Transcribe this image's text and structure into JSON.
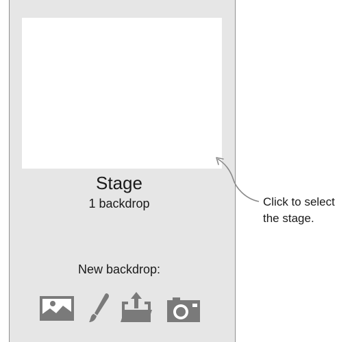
{
  "stage_panel": {
    "title": "Stage",
    "backdrop_count": "1 backdrop",
    "new_backdrop_label": "New backdrop:",
    "backdrop_options": [
      {
        "icon": "image-icon",
        "action": "choose-backdrop-from-library"
      },
      {
        "icon": "paintbrush-icon",
        "action": "paint-new-backdrop"
      },
      {
        "icon": "upload-icon",
        "action": "upload-backdrop-from-file"
      },
      {
        "icon": "camera-icon",
        "action": "new-backdrop-from-camera"
      }
    ]
  },
  "callout": {
    "line1": "Click to select",
    "line2": "the stage."
  },
  "colors": {
    "panel_background": "#e6e6e6",
    "panel_border": "#8f8f8f",
    "thumbnail_background": "#ffffff",
    "icon_fill": "#7a7a7a",
    "text": "#1a1a1a",
    "arrow": "#8a8a8a"
  }
}
